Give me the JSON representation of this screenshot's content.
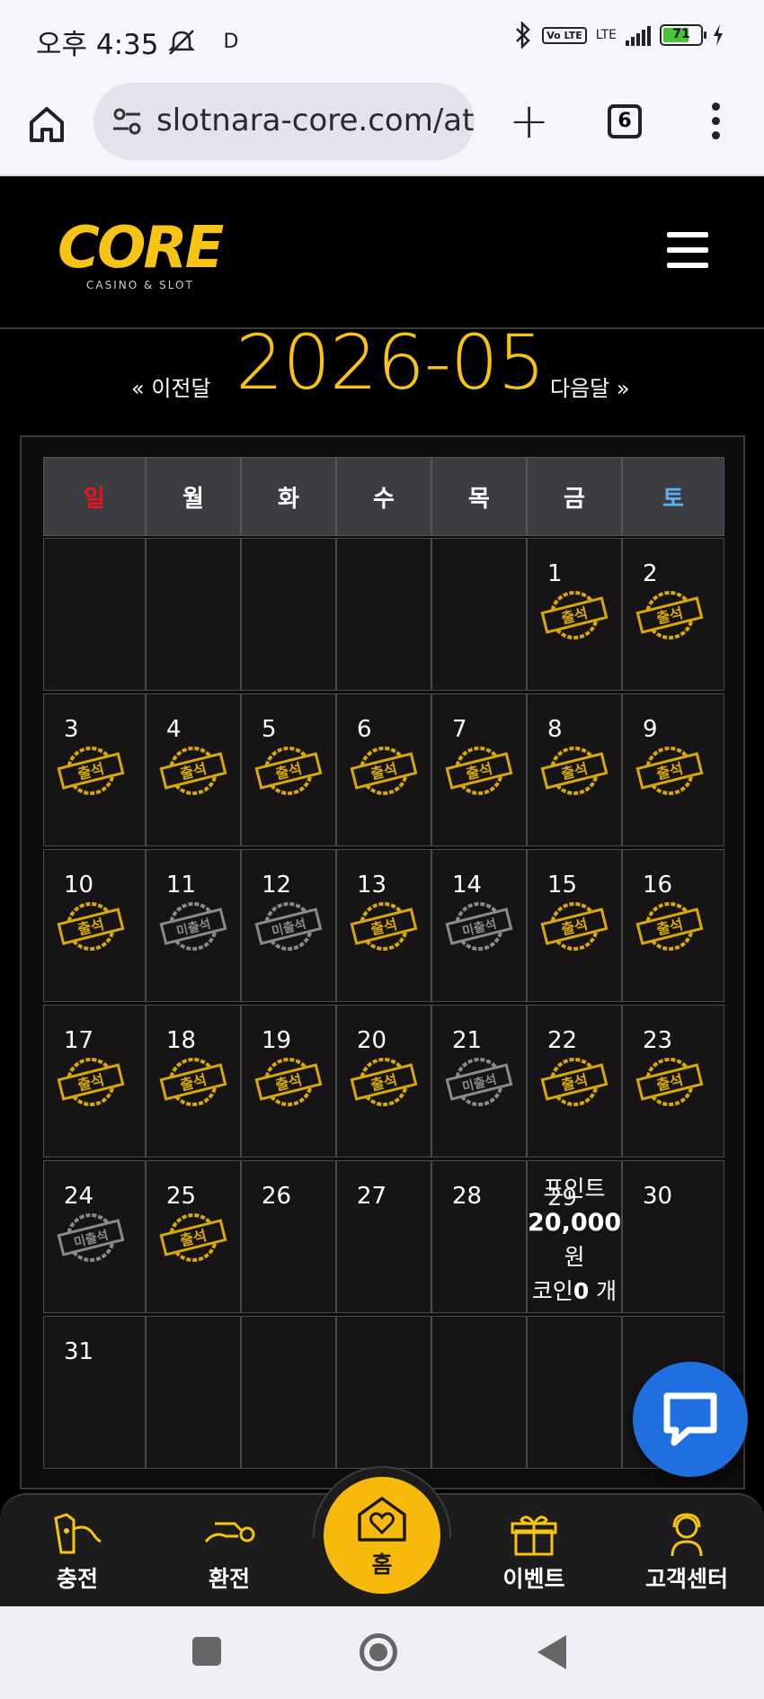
{
  "status_bar": {
    "time": "오후 4:35",
    "indicator": "D",
    "network": "LTE",
    "volte": "Vo LTE",
    "battery": "71",
    "icons": [
      "dnd-off-icon",
      "bluetooth-icon",
      "signal-icon",
      "battery-icon",
      "charging-icon"
    ]
  },
  "browser": {
    "url": "slotnara-core.com/attendance",
    "tab_count": "6"
  },
  "site": {
    "logo_text": "CORE",
    "logo_tagline": "CASINO & SLOT"
  },
  "calendar": {
    "prev_label": "« 이전달",
    "next_label": "다음달 »",
    "month": "2026-05",
    "weekdays": [
      "일",
      "월",
      "화",
      "수",
      "목",
      "금",
      "토"
    ],
    "weekday_colors": {
      "sun": "#e8141b",
      "sat": "#5ab0f0",
      "default": "#ffffff"
    },
    "stamp_present": "출석",
    "stamp_absent": "미출석",
    "days": [
      {
        "d": "1",
        "s": "p"
      },
      {
        "d": "2",
        "s": "p"
      },
      {
        "d": "3",
        "s": "p"
      },
      {
        "d": "4",
        "s": "p"
      },
      {
        "d": "5",
        "s": "p"
      },
      {
        "d": "6",
        "s": "p"
      },
      {
        "d": "7",
        "s": "p"
      },
      {
        "d": "8",
        "s": "p"
      },
      {
        "d": "9",
        "s": "p"
      },
      {
        "d": "10",
        "s": "p"
      },
      {
        "d": "11",
        "s": "a"
      },
      {
        "d": "12",
        "s": "a"
      },
      {
        "d": "13",
        "s": "p"
      },
      {
        "d": "14",
        "s": "a"
      },
      {
        "d": "15",
        "s": "p"
      },
      {
        "d": "16",
        "s": "p"
      },
      {
        "d": "17",
        "s": "p"
      },
      {
        "d": "18",
        "s": "p"
      },
      {
        "d": "19",
        "s": "p"
      },
      {
        "d": "20",
        "s": "p"
      },
      {
        "d": "21",
        "s": "a"
      },
      {
        "d": "22",
        "s": "p"
      },
      {
        "d": "23",
        "s": "p"
      },
      {
        "d": "24",
        "s": "a"
      },
      {
        "d": "25",
        "s": "p"
      },
      {
        "d": "26",
        "s": ""
      },
      {
        "d": "27",
        "s": ""
      },
      {
        "d": "28",
        "s": ""
      },
      {
        "d": "29",
        "s": ""
      },
      {
        "d": "30",
        "s": ""
      },
      {
        "d": "31",
        "s": ""
      }
    ],
    "first_weekday_index": 5,
    "today_info": {
      "point_label": "포인트",
      "point_value": "20,000",
      "point_unit": "원",
      "coin_label": "코인",
      "coin_value": "0",
      "coin_unit": "개"
    }
  },
  "bottom_nav": {
    "items": [
      {
        "label": "충전",
        "icon": "deposit-icon"
      },
      {
        "label": "환전",
        "icon": "withdraw-icon"
      },
      {
        "label": "홈",
        "icon": "home-heart-icon"
      },
      {
        "label": "이벤트",
        "icon": "gift-icon"
      },
      {
        "label": "고객센터",
        "icon": "support-agent-icon"
      }
    ]
  },
  "colors": {
    "accent": "#f7c315",
    "stamp_gold": "#d8a80a",
    "stamp_gray": "#8a8a8a",
    "chat": "#1f6fe0"
  }
}
